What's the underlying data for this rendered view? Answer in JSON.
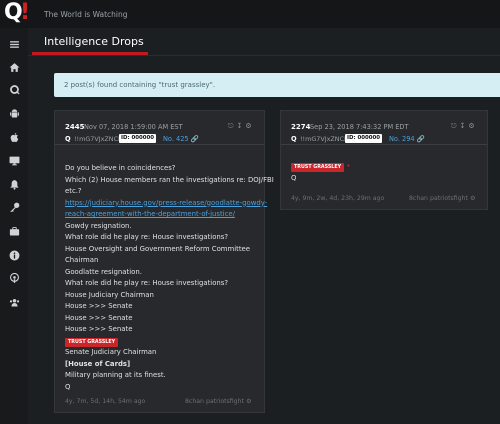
{
  "header": {
    "logo_text": "Q",
    "logo_mark": "!",
    "tagline": "The World is Watching"
  },
  "sidebar": {
    "items": [
      "menu-icon",
      "home-icon",
      "q-icon",
      "android-icon",
      "apple-icon",
      "desktop-icon",
      "bell-icon",
      "key-icon",
      "briefcase-icon",
      "info-icon",
      "podcast-icon",
      "users-icon"
    ]
  },
  "section": {
    "title": "Intelligence Drops"
  },
  "alert": {
    "text": "2 post(s) found containing \"trust grassley\"."
  },
  "posts": [
    {
      "number": "2445",
      "date": "Nov 07, 2018 1:59:00 AM EST",
      "name": "Q",
      "trip": "!!mG7VJxZNCI",
      "id_label": "ID: 000000",
      "no_link": "No. 425",
      "lines": [
        "Do you believe in coincidences?",
        "Which (2) House members ran the investigations re: DOJ/FBI",
        "etc.?",
        "https://judiciary.house.gov/press-release/goodlatte-gowdy-",
        "reach-agreement-with-the-department-of-justice/",
        "Gowdy resignation.",
        "What role did he play re: House investigations?",
        "House Oversight and Government Reform Committee",
        "Chairman",
        "Goodlatte resignation.",
        "What role did he play re: House investigations?",
        "House Judiciary Chairman",
        "House >>> Senate",
        "House >>> Senate",
        "House >>> Senate",
        "TRUST GRASSLEY",
        "Senate Judiciary Chairman",
        "[House of Cards]",
        "Military planning at its finest.",
        "Q"
      ],
      "age": "4y, 7m, 5d, 14h, 54m ago",
      "source": "8chan patriotsfight"
    },
    {
      "number": "2274",
      "date": "Sep 23, 2018 7:43:32 PM EDT",
      "name": "Q",
      "trip": "!!mG7VJxZNCI",
      "id_label": "ID: 000000",
      "no_link": "No. 294",
      "lines": [
        "TRUST GRASSLEY",
        "Q"
      ],
      "age": "4y, 9m, 2w, 4d, 23h, 29m ago",
      "source": "8chan patriotsfight"
    }
  ],
  "colors": {
    "accent": "#c0191f",
    "link": "#4aa0dc",
    "alert_bg": "#d4eef3"
  }
}
